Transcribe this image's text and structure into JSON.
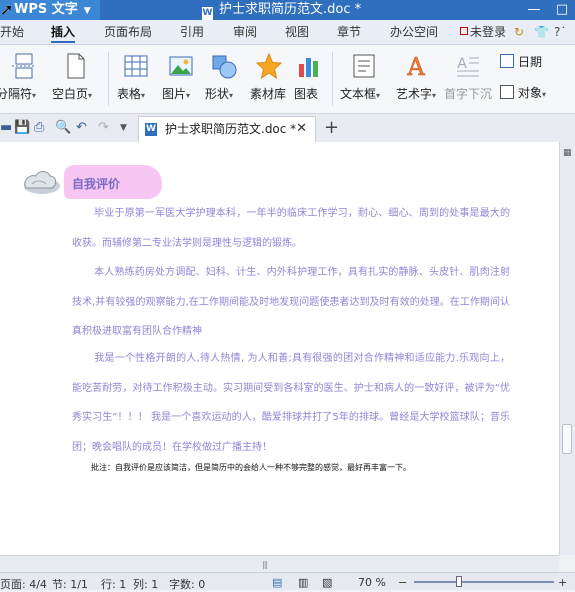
{
  "titlebar": {
    "app_name": "WPS 文字",
    "doc_title": "护士求职简历范文.doc *",
    "doc_icon": "W",
    "minimize": "—",
    "restore": "□"
  },
  "menu": {
    "tabs": [
      "开始",
      "插入",
      "页面布局",
      "引用",
      "审阅",
      "视图",
      "章节",
      "办公空间"
    ],
    "active": "插入",
    "login": "未登录"
  },
  "ribbon": {
    "items": [
      {
        "label": "分隔符",
        "icon": "page-break-icon"
      },
      {
        "label": "空白页",
        "icon": "blank-page-icon"
      },
      {
        "label": "表格",
        "icon": "table-icon"
      },
      {
        "label": "图片",
        "icon": "picture-icon"
      },
      {
        "label": "形状",
        "icon": "shapes-icon"
      },
      {
        "label": "素材库",
        "icon": "star-icon"
      },
      {
        "label": "图表",
        "icon": "chart-icon"
      },
      {
        "label": "文本框",
        "icon": "textbox-icon"
      },
      {
        "label": "艺术字",
        "icon": "wordart-icon"
      },
      {
        "label": "首字下沉",
        "icon": "dropcap-icon"
      },
      {
        "label": "日期",
        "icon": "date-icon"
      },
      {
        "label": "对象",
        "icon": "object-icon"
      }
    ]
  },
  "doc_tab": {
    "title": "护士求职简历范文.doc *",
    "icon": "W",
    "close": "✕",
    "add": "+"
  },
  "document": {
    "heading": "自我评价",
    "paragraphs": [
      "毕业于原第一军医大学护理本科，一年半的临床工作学习，耐心、细心、周到的处事是最大的收获。而辅修第二专业法学则是理性与逻辑的锻炼。",
      "本人熟练药房处方调配、妇科、计生、内外科护理工作，具有扎实的静脉、头皮针、肌肉注射技术,并有较强的观察能力,在工作期间能及时地发现问题使患者达到及时有效的处理。在工作期间认真积极进取富有团队合作精神",
      "我是一个性格开朗的人,待人热情, 为人和善;具有很强的团对合作精神和适应能力.乐观向上，能吃苦耐劳，对待工作积极主动。实习期间受到各科室的医生、护士和病人的一致好评，被评为“优秀实习生”！！！ 我是一个喜欢运动的人，酷爱排球并打了5年的排球。曾经是大学校篮球队；音乐团；晚会唱队的成员！在学校做过广播主持！"
    ],
    "note": "批注：自我评价是应该简洁，但是简历中的会给人一种不够完整的感觉，最好再丰富一下。"
  },
  "statusbar": {
    "page": "页面: 4/4",
    "section": "节: 1/1",
    "row": "行: 1",
    "col": "列: 1",
    "words": "字数: 0",
    "zoom": "70 %",
    "zoom_level": 0.3
  },
  "colors": {
    "title_bar": "#2f6fbd",
    "heading_band": "#f7c6f3",
    "body_text": "#8f86d6"
  }
}
